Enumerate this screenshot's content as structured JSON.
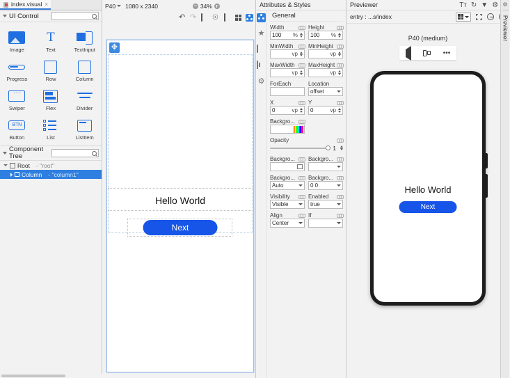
{
  "window": {
    "file_tab": "index.visual",
    "file_tab_close": "×"
  },
  "left_panel": {
    "ui_control": {
      "title": "UI Control",
      "search_placeholder": ""
    },
    "components": [
      {
        "label": "Image",
        "icon": "image-icon"
      },
      {
        "label": "Text",
        "icon": "text-icon"
      },
      {
        "label": "TextInput",
        "icon": "textinput-icon"
      },
      {
        "label": "Progress",
        "icon": "progress-icon"
      },
      {
        "label": "Row",
        "icon": "row-icon"
      },
      {
        "label": "Column",
        "icon": "column-icon"
      },
      {
        "label": "Swiper",
        "icon": "swiper-icon"
      },
      {
        "label": "Flex",
        "icon": "flex-icon"
      },
      {
        "label": "Divider",
        "icon": "divider-icon"
      },
      {
        "label": "Button",
        "icon": "button-icon",
        "glyph": "BTN"
      },
      {
        "label": "List",
        "icon": "list-icon"
      },
      {
        "label": "ListItem",
        "icon": "listitem-icon"
      }
    ],
    "component_tree": {
      "title": "Component Tree",
      "nodes": [
        {
          "label": "Root",
          "sub": "- \"root\""
        },
        {
          "label": "Column",
          "sub": "- \"column1\""
        }
      ]
    }
  },
  "canvas": {
    "device": "P40",
    "resolution": "1080 x 2340",
    "zoom": "34%",
    "toolbar_icons": [
      "undo-icon",
      "redo-icon",
      "device-icon",
      "pointer-icon",
      "frame-icon",
      "grid-icon",
      "nodes-icon"
    ],
    "preview": {
      "title": "Hello World",
      "button_label": "Next"
    }
  },
  "attributes": {
    "panel_title": "Attributes & Styles",
    "section": "General",
    "rail_icons": [
      "nodes-icon",
      "puzzle-icon",
      "monitor-icon",
      "frame-icon",
      "gear-icon"
    ],
    "fields": [
      {
        "label": "Width",
        "value": "100",
        "unit": "%",
        "type": "number"
      },
      {
        "label": "Height",
        "value": "100",
        "unit": "%",
        "type": "number"
      },
      {
        "label": "MinWidth",
        "value": "",
        "unit": "vp",
        "type": "number"
      },
      {
        "label": "MinHeight",
        "value": "",
        "unit": "vp",
        "type": "number"
      },
      {
        "label": "MaxWidth",
        "value": "",
        "unit": "vp",
        "type": "number"
      },
      {
        "label": "MaxHeight",
        "value": "",
        "unit": "vp",
        "type": "number"
      },
      {
        "label": "ForEach",
        "value": "",
        "unit": "",
        "type": "text"
      },
      {
        "label": "Location",
        "value": "offset",
        "unit": "",
        "type": "select"
      },
      {
        "label": "X",
        "value": "0",
        "unit": "vp",
        "type": "number"
      },
      {
        "label": "Y",
        "value": "0",
        "unit": "vp",
        "type": "number"
      },
      {
        "label": "Backgro...",
        "value": "",
        "unit": "",
        "type": "color"
      },
      {
        "label": "Opacity",
        "value": "1",
        "unit": "",
        "type": "slider"
      },
      {
        "label": "Backgro...",
        "value": "",
        "unit": "",
        "type": "image"
      },
      {
        "label": "Backgro...",
        "value": "",
        "unit": "",
        "type": "select"
      },
      {
        "label": "Backgro...",
        "value": "Auto",
        "unit": "",
        "type": "select"
      },
      {
        "label": "Backgro...",
        "value": "0 0",
        "unit": "",
        "type": "select"
      },
      {
        "label": "Visibility",
        "value": "Visible",
        "unit": "",
        "type": "select"
      },
      {
        "label": "Enabled",
        "value": "true",
        "unit": "",
        "type": "select"
      },
      {
        "label": "Align",
        "value": "Center",
        "unit": "",
        "type": "select"
      },
      {
        "label": "If",
        "value": "",
        "unit": "",
        "type": "select"
      }
    ]
  },
  "previewer": {
    "title": "Previewer",
    "header_icons": [
      "font-size-icon",
      "refresh-icon",
      "filter-icon",
      "settings-icon",
      "minimize-icon"
    ],
    "entry_path": "entry : ...s/index",
    "toolbar_icons": [
      "layout-grid-icon",
      "chevron-down-icon",
      "fit-screen-icon",
      "zoom-out-icon",
      "zoom-in-icon"
    ],
    "device_name": "P40 (medium)",
    "actions": [
      "back-icon",
      "rotate-icon",
      "more-icon"
    ],
    "more_glyph": "•••",
    "screen": {
      "title": "Hello World",
      "button_label": "Next"
    },
    "side_tab": "Previewer"
  },
  "colors": {
    "accent_blue": "#1655e8",
    "icon_blue": "#1f6fe0",
    "selection_blue": "#2f7fe0",
    "panel_bg": "#f2f2f2"
  }
}
